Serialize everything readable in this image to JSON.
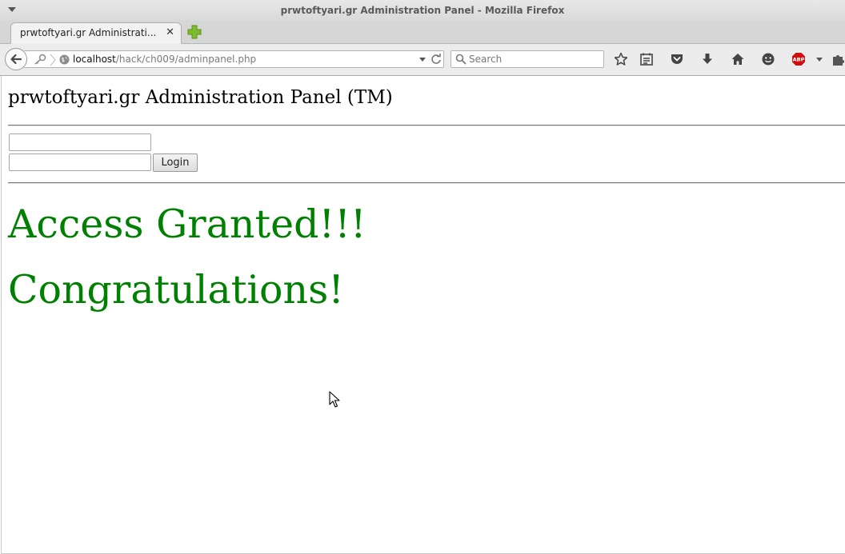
{
  "window": {
    "title": "prwtoftyari.gr Administration Panel - Mozilla Firefox"
  },
  "tabs": [
    {
      "label": "prwtoftyari.gr Administrati...",
      "active": true
    }
  ],
  "navbar": {
    "url_host": "localhost",
    "url_path": "/hack/ch009/adminpanel.php",
    "search_placeholder": "Search"
  },
  "toolbar_icons": [
    "star-icon",
    "reading-list-icon",
    "pocket-icon",
    "download-icon",
    "home-icon",
    "chat-icon",
    "adblock-icon",
    "menu-arrow-icon",
    "puzzle-icon"
  ],
  "page": {
    "heading": "prwtoftyari.gr Administration Panel (TM)",
    "username_value": "",
    "password_value": "",
    "login_label": "Login",
    "message_1": "Access Granted!!!",
    "message_2": "Congratulations!",
    "message_color": "#008000"
  },
  "colors": {
    "abp_badge": "#cc1111",
    "new_tab_plus": "#7cbc2b"
  }
}
